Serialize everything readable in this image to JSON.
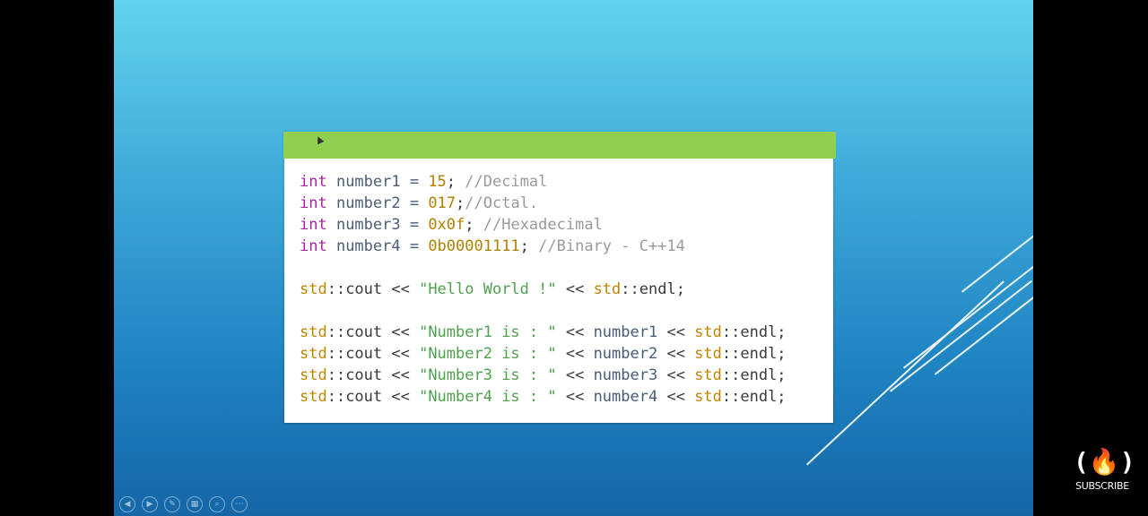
{
  "code": {
    "lines": [
      [
        {
          "t": "int",
          "c": "kw"
        },
        {
          "t": " number1 = ",
          "c": "id"
        },
        {
          "t": "15",
          "c": "num"
        },
        {
          "t": "; ",
          "c": "pl"
        },
        {
          "t": "//Decimal",
          "c": "cm"
        }
      ],
      [
        {
          "t": "int",
          "c": "kw"
        },
        {
          "t": " number2 = ",
          "c": "id"
        },
        {
          "t": "017",
          "c": "num"
        },
        {
          "t": ";",
          "c": "pl"
        },
        {
          "t": "//Octal.",
          "c": "cm"
        }
      ],
      [
        {
          "t": "int",
          "c": "kw"
        },
        {
          "t": " number3 = ",
          "c": "id"
        },
        {
          "t": "0x0f",
          "c": "num"
        },
        {
          "t": "; ",
          "c": "pl"
        },
        {
          "t": "//Hexadecimal",
          "c": "cm"
        }
      ],
      [
        {
          "t": "int",
          "c": "kw"
        },
        {
          "t": " number4 = ",
          "c": "id"
        },
        {
          "t": "0b00001111",
          "c": "num"
        },
        {
          "t": "; ",
          "c": "pl"
        },
        {
          "t": "//Binary - C++14",
          "c": "cm"
        }
      ],
      [],
      [
        {
          "t": "std",
          "c": "ty"
        },
        {
          "t": "::cout << ",
          "c": "pl"
        },
        {
          "t": "\"Hello World !\"",
          "c": "str"
        },
        {
          "t": " << ",
          "c": "pl"
        },
        {
          "t": "std",
          "c": "ty"
        },
        {
          "t": "::endl;",
          "c": "pl"
        }
      ],
      [],
      [
        {
          "t": "std",
          "c": "ty"
        },
        {
          "t": "::cout << ",
          "c": "pl"
        },
        {
          "t": "\"Number1 is : \"",
          "c": "str"
        },
        {
          "t": " << ",
          "c": "pl"
        },
        {
          "t": "number1",
          "c": "id"
        },
        {
          "t": " << ",
          "c": "pl"
        },
        {
          "t": "std",
          "c": "ty"
        },
        {
          "t": "::endl;",
          "c": "pl"
        }
      ],
      [
        {
          "t": "std",
          "c": "ty"
        },
        {
          "t": "::cout << ",
          "c": "pl"
        },
        {
          "t": "\"Number2 is : \"",
          "c": "str"
        },
        {
          "t": " << ",
          "c": "pl"
        },
        {
          "t": "number2",
          "c": "id"
        },
        {
          "t": " << ",
          "c": "pl"
        },
        {
          "t": "std",
          "c": "ty"
        },
        {
          "t": "::endl;",
          "c": "pl"
        }
      ],
      [
        {
          "t": "std",
          "c": "ty"
        },
        {
          "t": "::cout << ",
          "c": "pl"
        },
        {
          "t": "\"Number3 is : \"",
          "c": "str"
        },
        {
          "t": " << ",
          "c": "pl"
        },
        {
          "t": "number3",
          "c": "id"
        },
        {
          "t": " << ",
          "c": "pl"
        },
        {
          "t": "std",
          "c": "ty"
        },
        {
          "t": "::endl;",
          "c": "pl"
        }
      ],
      [
        {
          "t": "std",
          "c": "ty"
        },
        {
          "t": "::cout << ",
          "c": "pl"
        },
        {
          "t": "\"Number4 is : \"",
          "c": "str"
        },
        {
          "t": " << ",
          "c": "pl"
        },
        {
          "t": "number4",
          "c": "id"
        },
        {
          "t": " << ",
          "c": "pl"
        },
        {
          "t": "std",
          "c": "ty"
        },
        {
          "t": "::endl;",
          "c": "pl"
        }
      ]
    ]
  },
  "colors": {
    "header_bar": "#8fd14f",
    "slide_top": "#62d3ee",
    "slide_bottom": "#1666a6"
  },
  "nav": {
    "buttons": [
      {
        "name": "prev-slide-icon",
        "glyph": "◀"
      },
      {
        "name": "next-slide-icon",
        "glyph": "▶"
      },
      {
        "name": "pen-icon",
        "glyph": "✎"
      },
      {
        "name": "slides-grid-icon",
        "glyph": "▦"
      },
      {
        "name": "zoom-icon",
        "glyph": "⌕"
      },
      {
        "name": "more-options-icon",
        "glyph": "⋯"
      }
    ]
  },
  "logo": {
    "mark": "(🔥)",
    "subscribe": "SUBSCRIBE"
  }
}
